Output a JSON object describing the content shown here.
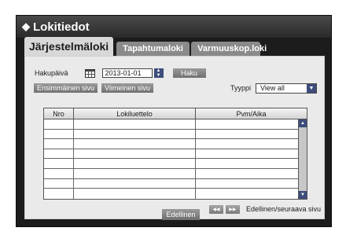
{
  "window": {
    "title": "Lokitiedot"
  },
  "tabs": [
    {
      "label": "Järjestelmäloki",
      "active": true
    },
    {
      "label": "Tapahtumaloki",
      "active": false
    },
    {
      "label": "Varmuuskop.loki",
      "active": false
    }
  ],
  "search": {
    "date_label": "Hakupäivä",
    "date_value": "2013-01-01",
    "search_button": "Haku"
  },
  "navigation": {
    "first_page": "Ensimmäinen sivu",
    "last_page": "Viimeinen sivu"
  },
  "type_filter": {
    "label": "Tyyppi",
    "selected": "View all"
  },
  "table": {
    "columns": [
      "Nro",
      "Lokiluettelo",
      "Pvm/Aika"
    ],
    "rows": [
      [
        "",
        "",
        ""
      ],
      [
        "",
        "",
        ""
      ],
      [
        "",
        "",
        ""
      ],
      [
        "",
        "",
        ""
      ],
      [
        "",
        "",
        ""
      ],
      [
        "",
        "",
        ""
      ],
      [
        "",
        "",
        ""
      ],
      [
        "",
        "",
        ""
      ]
    ]
  },
  "pager": {
    "label": "Edellinen/seuraava sivu"
  },
  "footer": {
    "back_button": "Edellinen"
  },
  "icons": {
    "title": "diamond-icon",
    "calendar": "calendar-icon",
    "spinner": "up-down-spinner-icon",
    "select_arrow": "chevron-down-icon",
    "prev_page": "double-chevron-left-icon",
    "next_page": "double-chevron-right-icon"
  },
  "colors": {
    "frame": "#1c1c1c",
    "panel": "#eaeaea",
    "button": "#808080",
    "accent": "#3d4c7c"
  }
}
